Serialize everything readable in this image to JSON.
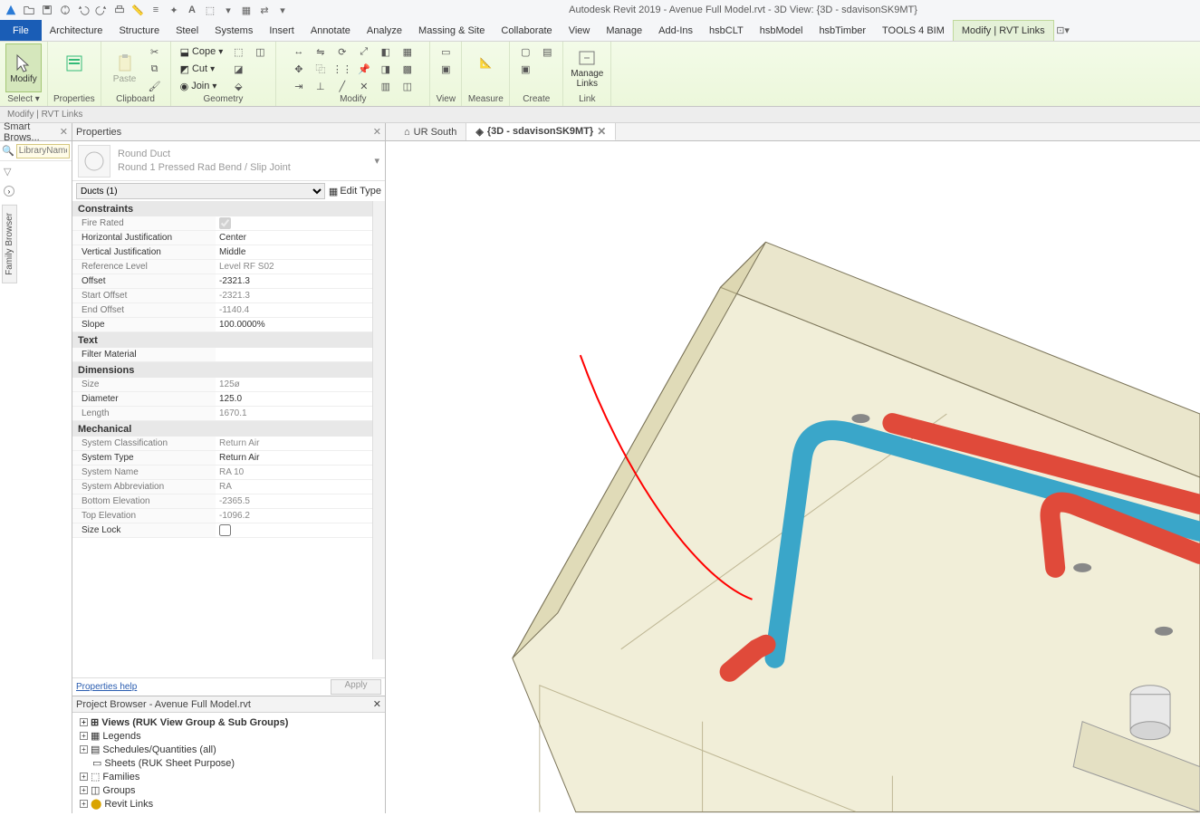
{
  "title": "Autodesk Revit 2019 - Avenue Full Model.rvt - 3D View: {3D - sdavisonSK9MT}",
  "menu": {
    "file": "File",
    "items": [
      "Architecture",
      "Structure",
      "Steel",
      "Systems",
      "Insert",
      "Annotate",
      "Analyze",
      "Massing & Site",
      "Collaborate",
      "View",
      "Manage",
      "Add-Ins",
      "hsbCLT",
      "hsbModel",
      "hsbTimber",
      "TOOLS 4 BIM",
      "Modify | RVT Links"
    ]
  },
  "ribbon": {
    "select": "Select ▾",
    "modify": "Modify",
    "properties": "Properties",
    "clipboard": "Clipboard",
    "paste": "Paste",
    "cope": "Cope",
    "cut": "Cut",
    "join": "Join",
    "geometry": "Geometry",
    "modify_grp": "Modify",
    "view": "View",
    "measure": "Measure",
    "create": "Create",
    "link": "Link",
    "manage_links": "Manage\nLinks"
  },
  "status_strip": "Modify | RVT Links",
  "smartbrowser_tab": "Smart Brows...",
  "library_placeholder": "LibraryName",
  "family_browser": "Family Browser",
  "properties_panel": {
    "title": "Properties",
    "type_family": "Round Duct",
    "type_name": "Round 1 Pressed Rad Bend / Slip Joint",
    "selector": "Ducts (1)",
    "edit_type": "Edit Type",
    "help": "Properties help",
    "apply": "Apply",
    "cats": {
      "constraints": "Constraints",
      "text": "Text",
      "dimensions": "Dimensions",
      "mechanical": "Mechanical"
    },
    "rows": {
      "fire_rated_k": "Fire Rated",
      "fire_rated_v": "",
      "hj_k": "Horizontal Justification",
      "hj_v": "Center",
      "vj_k": "Vertical Justification",
      "vj_v": "Middle",
      "rl_k": "Reference Level",
      "rl_v": "Level RF S02",
      "off_k": "Offset",
      "off_v": "-2321.3",
      "so_k": "Start Offset",
      "so_v": "-2321.3",
      "eo_k": "End Offset",
      "eo_v": "-1140.4",
      "sl_k": "Slope",
      "sl_v": "100.0000%",
      "fm_k": "Filter Material",
      "fm_v": "",
      "sz_k": "Size",
      "sz_v": "125ø",
      "dia_k": "Diameter",
      "dia_v": "125.0",
      "len_k": "Length",
      "len_v": "1670.1",
      "sc_k": "System Classification",
      "sc_v": "Return Air",
      "st_k": "System Type",
      "st_v": "Return Air",
      "sn_k": "System Name",
      "sn_v": "RA 10",
      "sa_k": "System Abbreviation",
      "sa_v": "RA",
      "be_k": "Bottom Elevation",
      "be_v": "-2365.5",
      "te_k": "Top Elevation",
      "te_v": "-1096.2",
      "slk_k": "Size Lock",
      "slk_v": ""
    }
  },
  "project_browser": {
    "title": "Project Browser - Avenue Full Model.rvt",
    "items": [
      "Views (RUK View Group & Sub Groups)",
      "Legends",
      "Schedules/Quantities (all)",
      "Sheets (RUK Sheet Purpose)",
      "Families",
      "Groups",
      "Revit Links"
    ]
  },
  "view_tabs": {
    "t1": "UR South",
    "t2": "{3D - sdavisonSK9MT}"
  }
}
